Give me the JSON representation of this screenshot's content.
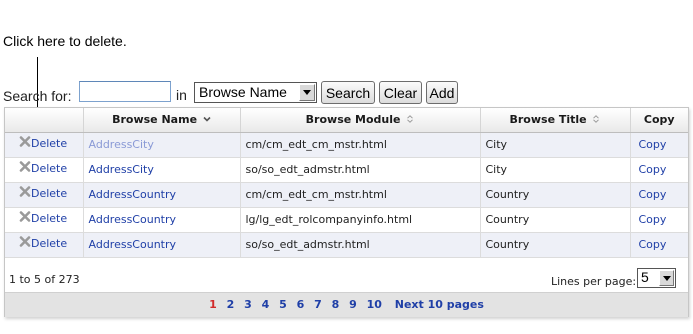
{
  "callout": {
    "text": "Click here to delete."
  },
  "search": {
    "label": "Search for:",
    "value": "",
    "in_label": "in",
    "field_select": "Browse Name",
    "buttons": {
      "search": "Search",
      "clear": "Clear",
      "add": "Add"
    }
  },
  "grid": {
    "headers": {
      "browse_name": "Browse Name",
      "browse_module": "Browse Module",
      "browse_title": "Browse Title",
      "copy": "Copy"
    },
    "rows": [
      {
        "delete": "Delete",
        "name": "AddressCity",
        "module": "cm/cm_edt_cm_mstr.html",
        "title": "City",
        "copy": "Copy"
      },
      {
        "delete": "Delete",
        "name": "AddressCity",
        "module": "so/so_edt_admstr.html",
        "title": "City",
        "copy": "Copy"
      },
      {
        "delete": "Delete",
        "name": "AddressCountry",
        "module": "cm/cm_edt_cm_mstr.html",
        "title": "Country",
        "copy": "Copy"
      },
      {
        "delete": "Delete",
        "name": "AddressCountry",
        "module": "lg/lg_edt_rolcompanyinfo.html",
        "title": "Country",
        "copy": "Copy"
      },
      {
        "delete": "Delete",
        "name": "AddressCountry",
        "module": "so/so_edt_admstr.html",
        "title": "Country",
        "copy": "Copy"
      }
    ],
    "range_text": "1 to 5 of 273",
    "lines_per_page_label": "Lines per page:",
    "lines_per_page": "5",
    "pages": [
      "1",
      "2",
      "3",
      "4",
      "5",
      "6",
      "7",
      "8",
      "9",
      "10"
    ],
    "current_page": "1",
    "next_label": "Next 10 pages"
  },
  "colors": {
    "link": "#1f3fa7",
    "visited_link": "#8a9ad6",
    "current_page": "#d12a2a",
    "row_alt": "#eef0f7"
  },
  "icons": {
    "delete": "x-delete-icon",
    "sort_desc": "chevron-down-icon",
    "sort_both": "sort-updown-icon",
    "dropdown": "dropdown-arrow-icon"
  }
}
